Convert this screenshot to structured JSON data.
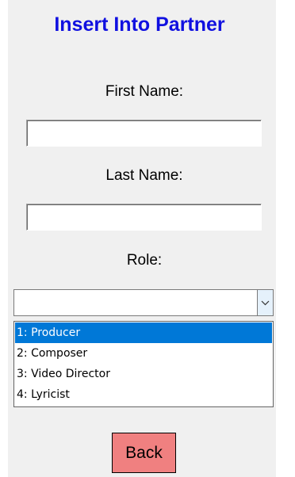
{
  "page": {
    "title": "Insert Into Partner"
  },
  "form": {
    "first_name": {
      "label": "First Name:",
      "value": ""
    },
    "last_name": {
      "label": "Last Name:",
      "value": ""
    },
    "role": {
      "label": "Role:",
      "value": "",
      "options": [
        "1: Producer",
        "2: Composer",
        "3: Video Director",
        "4: Lyricist"
      ],
      "highlighted_index": 0
    }
  },
  "actions": {
    "back_label": "Back"
  },
  "colors": {
    "title": "#1010e0",
    "window_background": "#f0f0f0",
    "highlight": "#0078d7",
    "back_button": "#f08080"
  },
  "icons": {
    "combo_arrow": "chevron-down-icon"
  }
}
